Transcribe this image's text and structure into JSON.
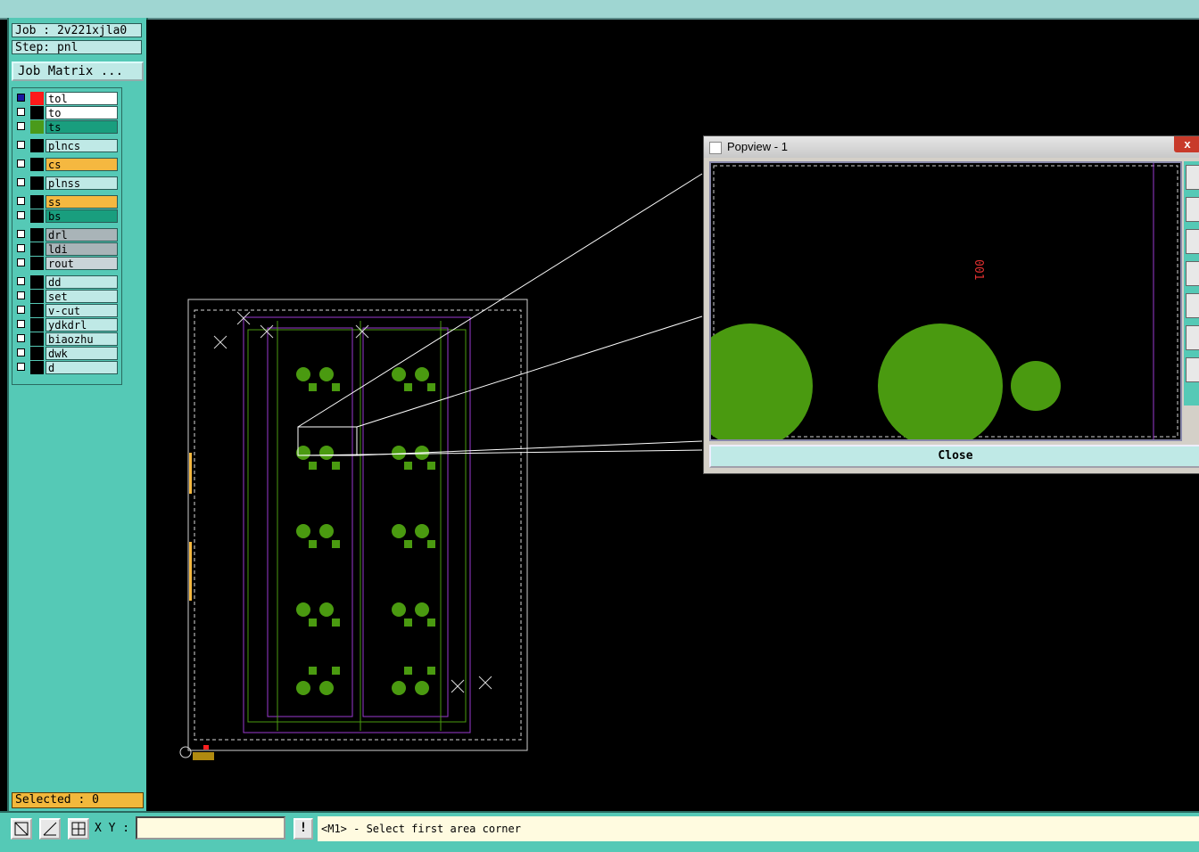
{
  "job": {
    "label": "Job : 2v221xjla0",
    "step": "Step: pnl"
  },
  "job_matrix_label": "Job Matrix ...",
  "layers": [
    {
      "name": "tol",
      "color": "#ffffff",
      "swatch": "#ff1a1a",
      "checked": true
    },
    {
      "name": "to",
      "color": "#ffffff",
      "swatch": "#000000",
      "checked": false
    },
    {
      "name": "ts",
      "color": "#199e7e",
      "swatch": "#4a9a1a",
      "checked": false
    },
    {
      "name": "plncs",
      "color": "#bfe9e6",
      "swatch": "#000000",
      "checked": false
    },
    {
      "name": "cs",
      "color": "#f5b840",
      "swatch": "#000000",
      "checked": false
    },
    {
      "name": "plnss",
      "color": "#bfe9e6",
      "swatch": "#000000",
      "checked": false
    },
    {
      "name": "ss",
      "color": "#f5b840",
      "swatch": "#000000",
      "checked": false
    },
    {
      "name": "bs",
      "color": "#199e7e",
      "swatch": "#000000",
      "checked": false
    },
    {
      "name": "drl",
      "color": "#a9b4b8",
      "swatch": "#000000",
      "checked": false
    },
    {
      "name": "ldi",
      "color": "#a9b4b8",
      "swatch": "#000000",
      "checked": false
    },
    {
      "name": "rout",
      "color": "#c9d4d8",
      "swatch": "#000000",
      "checked": false
    },
    {
      "name": "dd",
      "color": "#bfe9e6",
      "swatch": "#000000",
      "checked": false
    },
    {
      "name": "set",
      "color": "#bfe9e6",
      "swatch": "#000000",
      "checked": false
    },
    {
      "name": "v-cut",
      "color": "#bfe9e6",
      "swatch": "#000000",
      "checked": false
    },
    {
      "name": "ydkdrl",
      "color": "#bfe9e6",
      "swatch": "#000000",
      "checked": false
    },
    {
      "name": "biaozhu",
      "color": "#bfe9e6",
      "swatch": "#000000",
      "checked": false
    },
    {
      "name": "dwk",
      "color": "#bfe9e6",
      "swatch": "#000000",
      "checked": false
    },
    {
      "name": "d",
      "color": "#bfe9e6",
      "swatch": "#000000",
      "checked": false
    }
  ],
  "selected_label": "Selected : 0",
  "status": {
    "xy_label": "X Y :",
    "xy_value": "",
    "info_icon": "!",
    "prompt": "<M1> - Select first area corner"
  },
  "popview": {
    "title": "Popview - 1",
    "close_label": "Close",
    "close_x": "x",
    "mark_text": "001"
  },
  "colors": {
    "pad": "#4a9a10",
    "outline": "#9a3ad0",
    "panel": "#55c9b6"
  },
  "icons": [
    "zoom-area-icon",
    "measure-icon",
    "snap-grid-icon",
    "info-icon"
  ]
}
